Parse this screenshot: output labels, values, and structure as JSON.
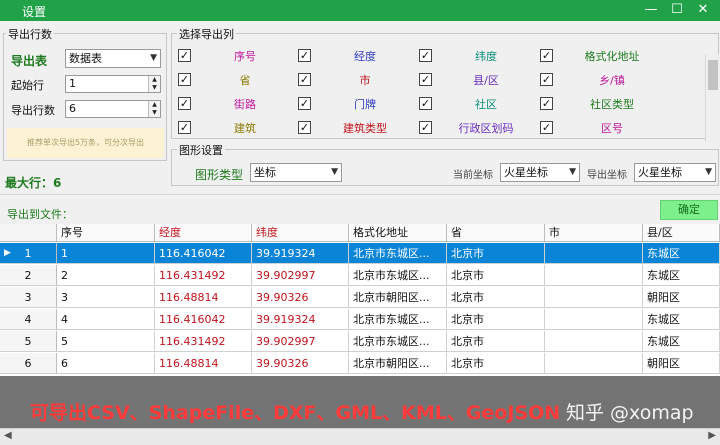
{
  "window": {
    "title": "设置"
  },
  "export_rows": {
    "group_title": "导出行数",
    "table_label": "导出表",
    "table_value": "数据表",
    "start_row_label": "起始行",
    "start_row_value": "1",
    "row_count_label": "导出行数",
    "row_count_value": "6",
    "hint": "推荐单次导出5万条，可分次导出",
    "max_rows": "最大行：6"
  },
  "columns_group": {
    "title": "选择导出列",
    "items": [
      {
        "label": "序号",
        "color": "#c0169b"
      },
      {
        "label": "经度",
        "color": "#2f3cc0"
      },
      {
        "label": "纬度",
        "color": "#0a8f7a"
      },
      {
        "label": "格式化地址",
        "color": "#1e7a1e"
      },
      {
        "label": "省",
        "color": "#8a7a00"
      },
      {
        "label": "市",
        "color": "#c0131c"
      },
      {
        "label": "县/区",
        "color": "#6a2fc0"
      },
      {
        "label": "乡/镇",
        "color": "#c0169b"
      },
      {
        "label": "街路",
        "color": "#c0169b"
      },
      {
        "label": "门牌",
        "color": "#2f3cc0"
      },
      {
        "label": "社区",
        "color": "#0a8f7a"
      },
      {
        "label": "社区类型",
        "color": "#1e7a1e"
      },
      {
        "label": "建筑",
        "color": "#8a7a00"
      },
      {
        "label": "建筑类型",
        "color": "#c0131c"
      },
      {
        "label": "行政区划码",
        "color": "#6a2fc0"
      },
      {
        "label": "区号",
        "color": "#c0169b"
      }
    ]
  },
  "graphics": {
    "group_title": "图形设置",
    "type_label": "图形类型",
    "type_value": "坐标",
    "current_coord_label": "当前坐标",
    "current_coord_value": "火星坐标",
    "export_coord_label": "导出坐标",
    "export_coord_value": "火星坐标"
  },
  "export_file": {
    "label": "导出到文件：",
    "confirm": "确定"
  },
  "table": {
    "headers": [
      "序号",
      "经度",
      "纬度",
      "格式化地址",
      "省",
      "市",
      "县/区"
    ],
    "header_colors": [
      "#111111",
      "#c0131c",
      "#c0131c",
      "#111111",
      "#111111",
      "#111111",
      "#111111"
    ],
    "rows": [
      {
        "rh": "1",
        "cells": [
          "1",
          "116.416042",
          "39.919324",
          "北京市东城区...",
          "北京市",
          "",
          "东城区"
        ]
      },
      {
        "rh": "2",
        "cells": [
          "2",
          "116.431492",
          "39.902997",
          "北京市东城区...",
          "北京市",
          "",
          "东城区"
        ]
      },
      {
        "rh": "3",
        "cells": [
          "3",
          "116.48814",
          "39.90326",
          "北京市朝阳区...",
          "北京市",
          "",
          "朝阳区"
        ]
      },
      {
        "rh": "4",
        "cells": [
          "4",
          "116.416042",
          "39.919324",
          "北京市东城区...",
          "北京市",
          "",
          "东城区"
        ]
      },
      {
        "rh": "5",
        "cells": [
          "5",
          "116.431492",
          "39.902997",
          "北京市东城区...",
          "北京市",
          "",
          "东城区"
        ]
      },
      {
        "rh": "6",
        "cells": [
          "6",
          "116.48814",
          "39.90326",
          "北京市朝阳区...",
          "北京市",
          "",
          "朝阳区"
        ]
      }
    ]
  },
  "overlay": {
    "caption": "可导出CSV、ShapeFile、DXF、GML、KML、GeoJSON",
    "watermark": "知乎 @xomap"
  },
  "colors": {
    "title_bar": "#22a248",
    "selection": "#0a84d6",
    "number_red": "#c0131c",
    "label_green": "#1e7a1e"
  }
}
